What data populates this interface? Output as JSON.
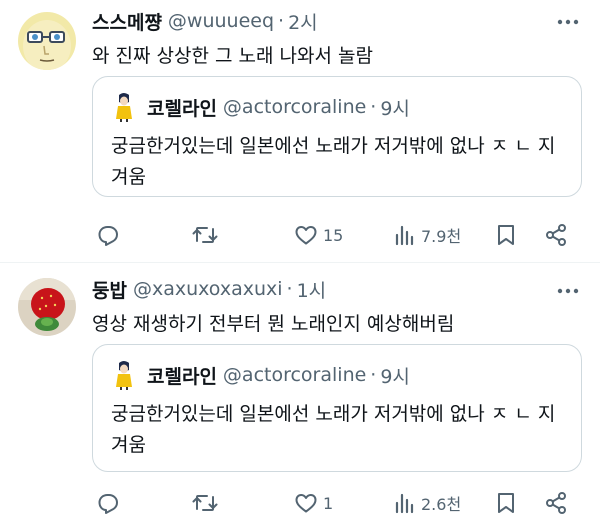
{
  "tweets": [
    {
      "name": "스스메쨩",
      "handle": "@wuuueeq",
      "dot": "·",
      "time": "2시",
      "text": "와 진짜 상상한 그 노래 나와서 놀람",
      "quote": {
        "name": "코렐라인",
        "handle": "@actorcoraline",
        "dot": "·",
        "time": "9시",
        "text": "궁금한거있는데 일본에선 노래가 저거밖에 없나 ㅈ ㄴ 지겨움"
      },
      "stats": {
        "reply": "",
        "retweet": "",
        "like": "15",
        "views": "7.9천"
      }
    },
    {
      "name": "둥밥",
      "handle": "@xaxuxoxaxuxi",
      "dot": "·",
      "time": "1시",
      "text": "영상 재생하기 전부터 뭔 노래인지 예상해버림",
      "quote": {
        "name": "코렐라인",
        "handle": "@actorcoraline",
        "dot": "·",
        "time": "9시",
        "text": "궁금한거있는데 일본에선 노래가 저거밖에 없나 ㅈ ㄴ 지겨움"
      },
      "stats": {
        "reply": "",
        "retweet": "",
        "like": "1",
        "views": "2.6천"
      }
    }
  ],
  "icons": {
    "reply": "reply-icon",
    "retweet": "retweet-icon",
    "like": "heart-icon",
    "views": "views-icon",
    "bookmark": "bookmark-icon",
    "share": "share-icon",
    "more": "more-icon"
  },
  "colors": {
    "text": "#0f1419",
    "secondary": "#536471",
    "border": "#cfd9de",
    "separator": "#eff3f4"
  }
}
